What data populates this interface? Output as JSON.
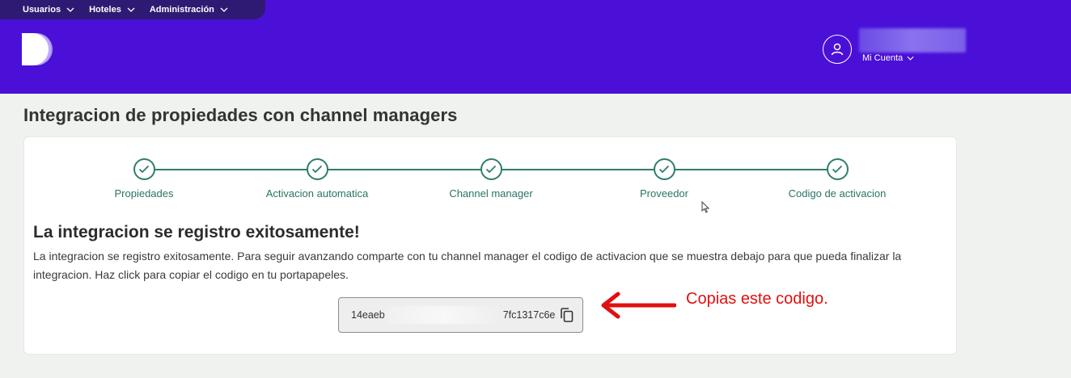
{
  "nav": {
    "items": [
      {
        "label": "Usuarios"
      },
      {
        "label": "Hoteles"
      },
      {
        "label": "Administración"
      }
    ]
  },
  "account": {
    "menu_label": "Mi Cuenta"
  },
  "page": {
    "title": "Integracion de propiedades con channel managers"
  },
  "stepper": {
    "steps": [
      {
        "label": "Propiedades",
        "completed": true
      },
      {
        "label": "Activacion automatica",
        "completed": true
      },
      {
        "label": "Channel manager",
        "completed": true
      },
      {
        "label": "Proveedor",
        "completed": true
      },
      {
        "label": "Codigo de activacion",
        "completed": true
      }
    ]
  },
  "success": {
    "title": "La integracion se registro exitosamente!",
    "text": "La integracion se registro exitosamente. Para seguir avanzando comparte con tu channel manager el codigo de activacion que se muestra debajo para que pueda finalizar la integracion. Haz click para copiar el codigo en tu portapapeles."
  },
  "code": {
    "prefix": "14eaeb",
    "suffix": "7fc1317c6e"
  },
  "annotation": {
    "text": "Copias este codigo."
  },
  "colors": {
    "header": "#4a10d8",
    "topnav": "#2f1a73",
    "accent": "#2f7d6d",
    "annotation": "#e01010"
  }
}
